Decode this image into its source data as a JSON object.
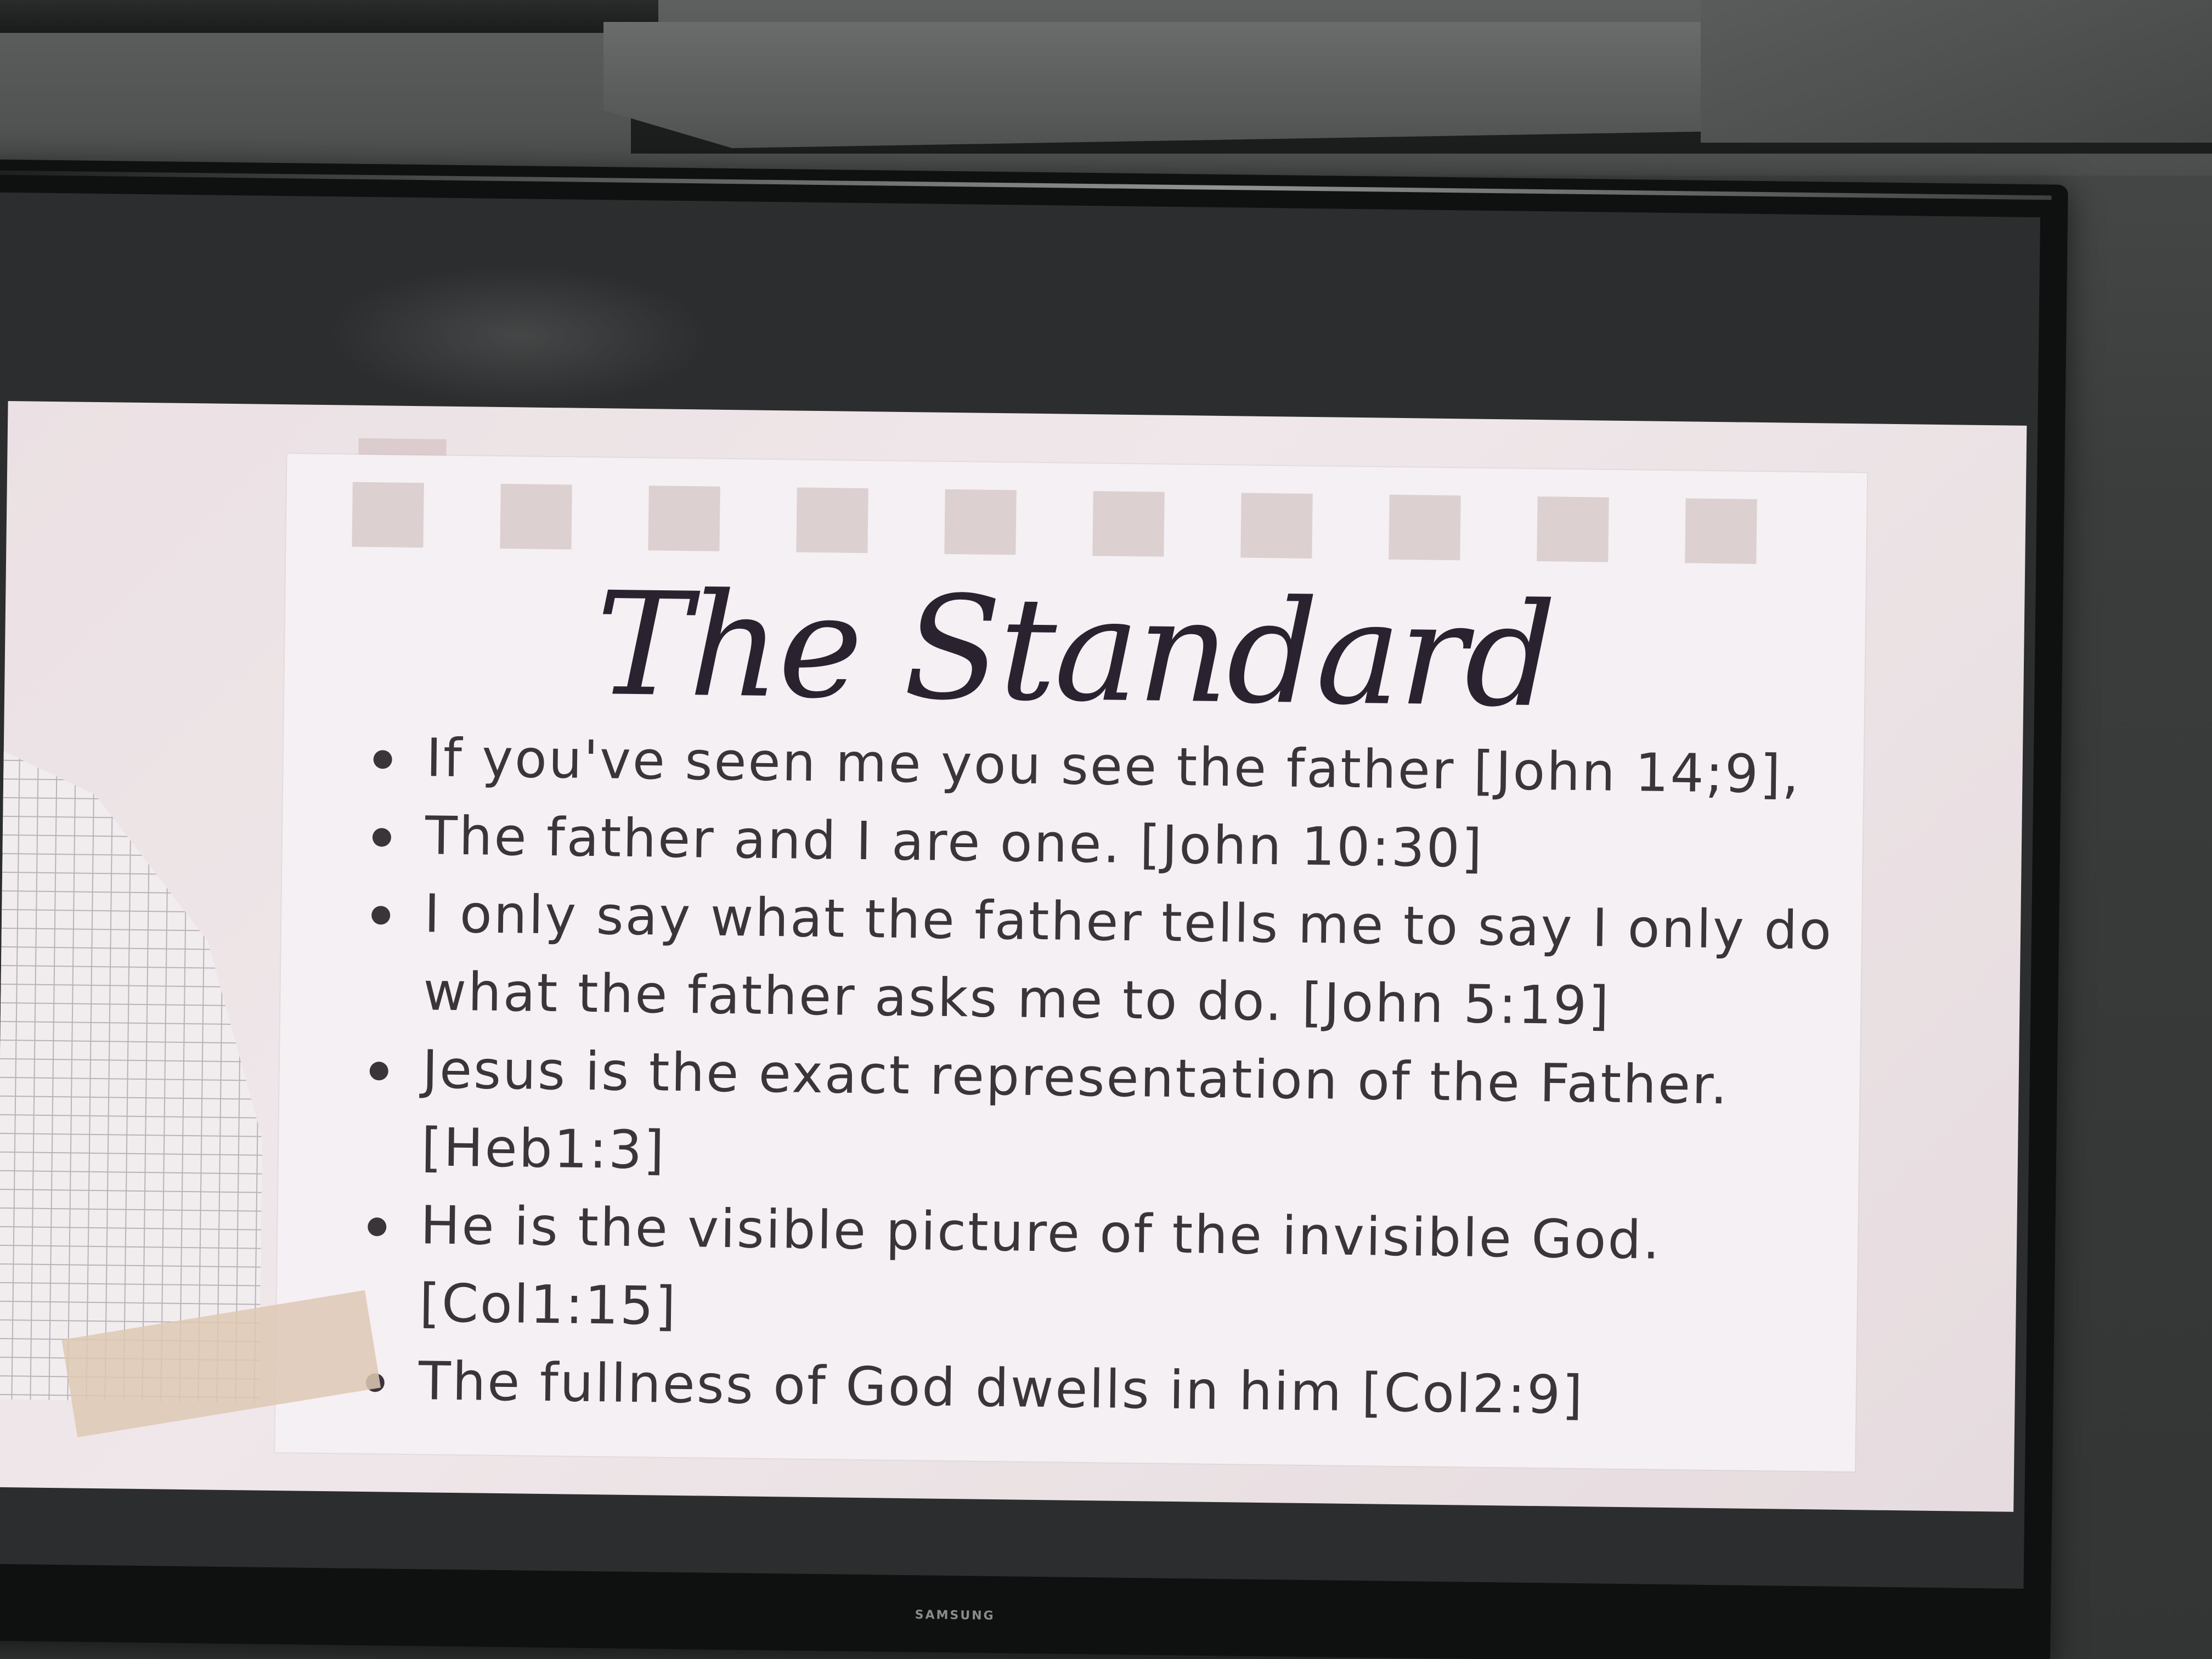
{
  "slide": {
    "title": "The Standard",
    "bullets": [
      "If you've seen me you see the father [John 14;9],",
      "The father and I are one. [John 10:30]",
      "I only say what the father tells me to say I only do what the father asks me to do. [John 5:19]",
      "Jesus is the exact representation of the Father. [Heb1:3]",
      "He is the visible picture of the invisible God. [Col1:15]",
      "The fullness of God dwells in him [Col2:9]"
    ]
  },
  "tv": {
    "brand": "SAMSUNG"
  }
}
